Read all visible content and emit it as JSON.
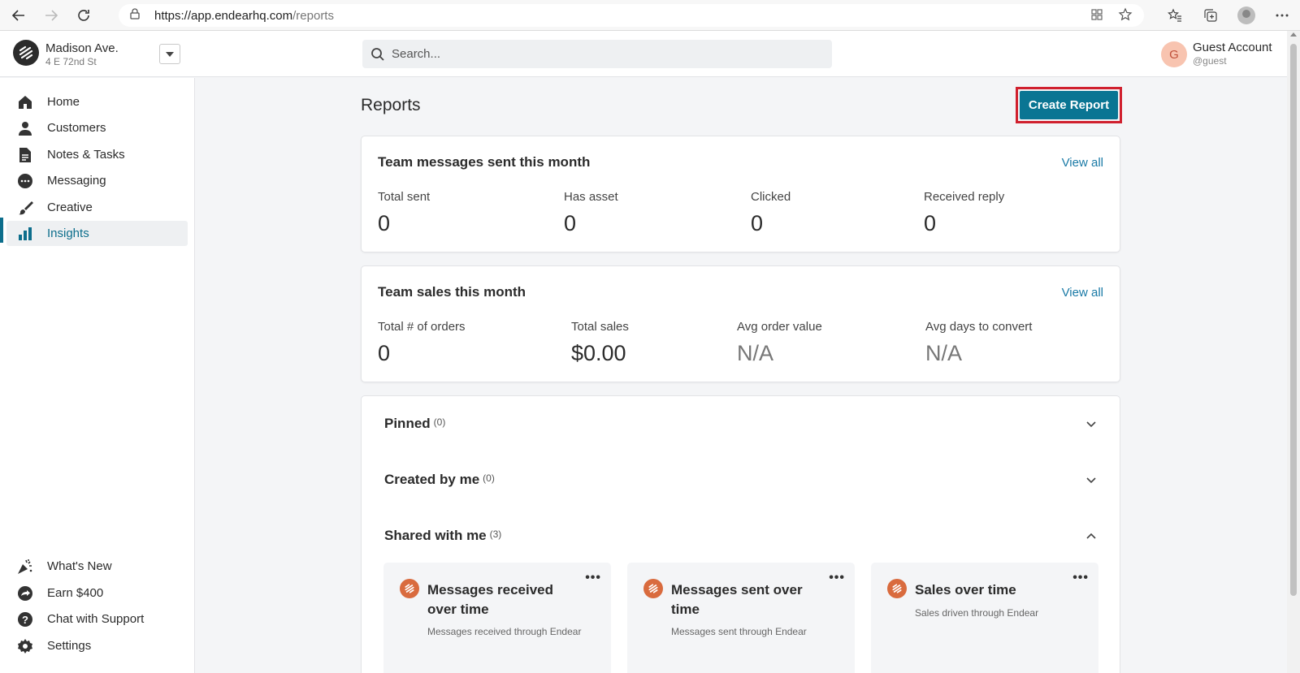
{
  "browser": {
    "url_host": "https://app.endearhq.com",
    "url_path": "/reports"
  },
  "header": {
    "store_name": "Madison Ave.",
    "store_address": "4 E 72nd St",
    "search_placeholder": "Search...",
    "avatar_initial": "G",
    "user_name": "Guest Account",
    "user_handle": "@guest"
  },
  "sidebar": {
    "items": [
      {
        "label": "Home",
        "icon": "home-icon"
      },
      {
        "label": "Customers",
        "icon": "person-icon"
      },
      {
        "label": "Notes & Tasks",
        "icon": "document-icon"
      },
      {
        "label": "Messaging",
        "icon": "chat-bubble-icon"
      },
      {
        "label": "Creative",
        "icon": "brush-icon"
      },
      {
        "label": "Insights",
        "icon": "bar-chart-icon",
        "active": true
      }
    ],
    "bottom_items": [
      {
        "label": "What's New",
        "icon": "sparkle-icon"
      },
      {
        "label": "Earn $400",
        "icon": "share-icon"
      },
      {
        "label": "Chat with Support",
        "icon": "help-icon"
      },
      {
        "label": "Settings",
        "icon": "gear-icon"
      }
    ]
  },
  "main": {
    "title": "Reports",
    "create_button": "Create Report",
    "messages_card": {
      "title": "Team messages sent this month",
      "view_all": "View all",
      "stats": [
        {
          "label": "Total sent",
          "value": "0"
        },
        {
          "label": "Has asset",
          "value": "0"
        },
        {
          "label": "Clicked",
          "value": "0"
        },
        {
          "label": "Received reply",
          "value": "0"
        }
      ]
    },
    "sales_card": {
      "title": "Team sales this month",
      "view_all": "View all",
      "stats": [
        {
          "label": "Total # of orders",
          "value": "0"
        },
        {
          "label": "Total sales",
          "value": "$0.00"
        },
        {
          "label": "Avg order value",
          "value": "N/A"
        },
        {
          "label": "Avg days to convert",
          "value": "N/A"
        }
      ]
    },
    "sections": [
      {
        "title": "Pinned",
        "count": "(0)",
        "expanded": false
      },
      {
        "title": "Created by me",
        "count": "(0)",
        "expanded": false
      },
      {
        "title": "Shared with me",
        "count": "(3)",
        "expanded": true
      }
    ],
    "shared_reports": [
      {
        "title": "Messages received over time",
        "description": "Messages received through Endear",
        "more": "•••"
      },
      {
        "title": "Messages sent over time",
        "description": "Messages sent through Endear",
        "more": "•••"
      },
      {
        "title": "Sales over time",
        "description": "Sales driven through Endear",
        "more": "•••"
      }
    ]
  },
  "colors": {
    "accent": "#0a7593",
    "link": "#1a7aa6",
    "highlight_outline": "#d0202e",
    "report_logo": "#d96b3e"
  }
}
